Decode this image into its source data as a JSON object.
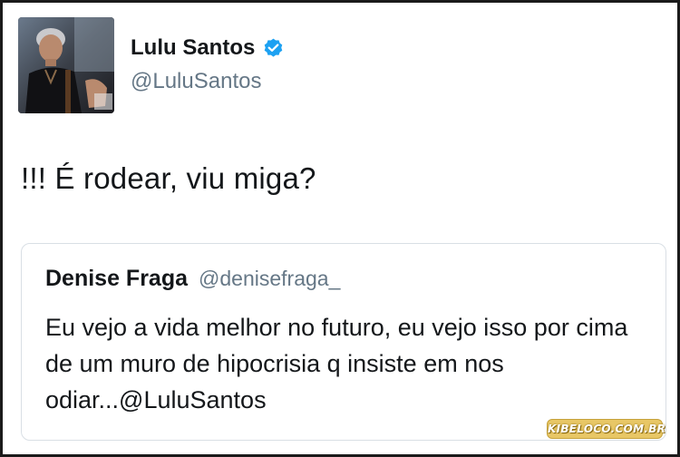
{
  "tweet": {
    "author": {
      "display_name": "Lulu Santos",
      "handle": "@LuluSantos",
      "avatar_icon": "person-photo-icon",
      "verified": true,
      "verified_icon": "verified-badge-icon"
    },
    "text": "!!! É rodear, viu miga?"
  },
  "quoted_tweet": {
    "author": {
      "display_name": "Denise Fraga",
      "handle": "@denisefraga_"
    },
    "text": "Eu vejo a vida melhor no futuro, eu vejo isso por cima de um muro de hipocrisia q insiste em nos odiar...@LuluSantos"
  },
  "watermark": {
    "text": "KIBELOCO.COM.BR"
  },
  "colors": {
    "text": "#14171a",
    "secondary_text": "#657786",
    "verified_blue": "#1da1f2",
    "border": "#d9dfe5",
    "watermark_bg": "#e8c766"
  }
}
